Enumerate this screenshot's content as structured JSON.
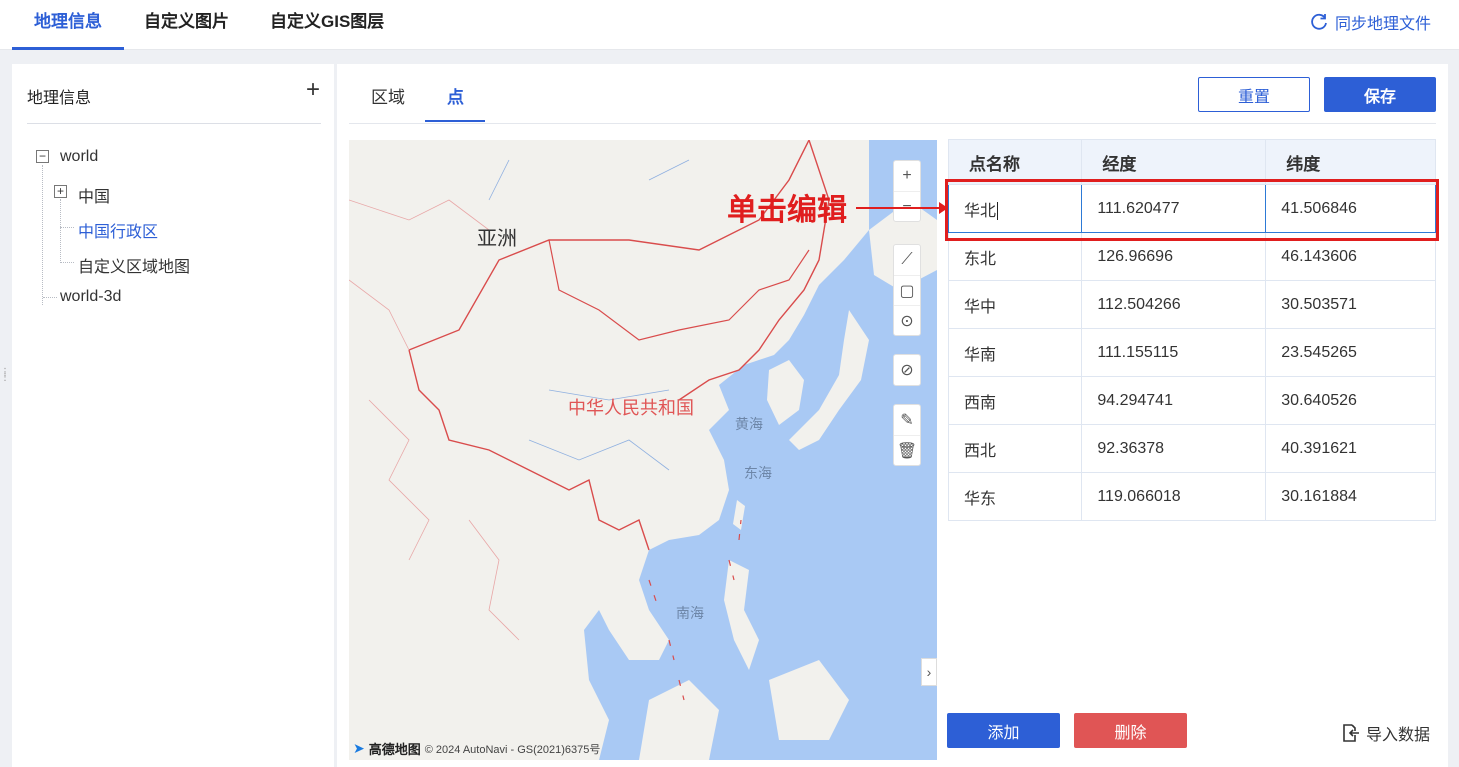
{
  "top_tabs": [
    "地理信息",
    "自定义图片",
    "自定义GIS图层"
  ],
  "sync_label": "同步地理文件",
  "left": {
    "title": "地理信息",
    "tree": {
      "world": "world",
      "china": "中国",
      "china_admin": "中国行政区",
      "custom_region": "自定义区域地图",
      "world3d": "world-3d"
    }
  },
  "sub_tabs": [
    "区域",
    "点"
  ],
  "buttons": {
    "reset": "重置",
    "save": "保存",
    "add": "添加",
    "delete": "删除",
    "import": "导入数据"
  },
  "map": {
    "labels": {
      "asia": "亚洲",
      "china": "中华人民共和国",
      "yellow_sea": "黄海",
      "east_sea": "东海",
      "south_sea": "南海"
    },
    "logo": "高德地图",
    "copyright": "© 2024 AutoNavi - GS(2021)6375号"
  },
  "table": {
    "headers": [
      "点名称",
      "经度",
      "纬度"
    ],
    "rows": [
      [
        "华北",
        "111.620477",
        "41.506846"
      ],
      [
        "东北",
        "126.96696",
        "46.143606"
      ],
      [
        "华中",
        "112.504266",
        "30.503571"
      ],
      [
        "华南",
        "111.155115",
        "23.545265"
      ],
      [
        "西南",
        "94.294741",
        "30.640526"
      ],
      [
        "西北",
        "92.36378",
        "40.391621"
      ],
      [
        "华东",
        "119.066018",
        "30.161884"
      ]
    ]
  },
  "annotation": "单击编辑",
  "colors": {
    "accent": "#2d5fd6",
    "danger": "#e05555",
    "annotation": "#e01e1e",
    "sea": "#a8c8f4"
  }
}
